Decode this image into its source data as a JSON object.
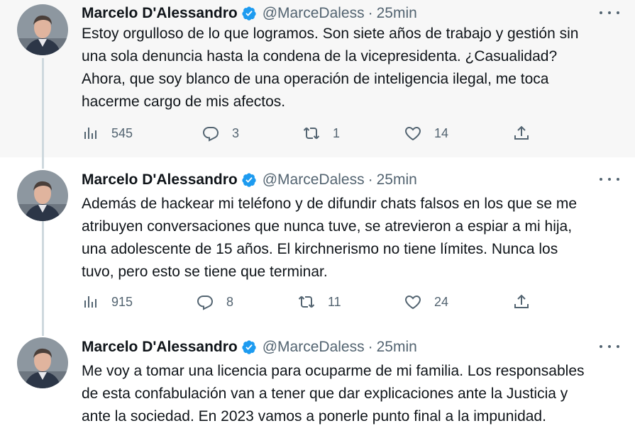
{
  "tweets": [
    {
      "author": {
        "name": "Marcelo D'Alessandro",
        "handle": "@MarceDaless",
        "verified": true
      },
      "separator": "·",
      "time": "25min",
      "text": "Estoy orgulloso de lo que logramos. Son siete años de trabajo y gestión sin\nuna sola denuncia hasta la condena de la vicepresidenta. ¿Casualidad?\nAhora, que soy blanco de una operación de inteligencia ilegal, me toca\nhacerme cargo de mis afectos.",
      "views": "545",
      "replies": "3",
      "retweets": "1",
      "likes": "14"
    },
    {
      "author": {
        "name": "Marcelo D'Alessandro",
        "handle": "@MarceDaless",
        "verified": true
      },
      "separator": "·",
      "time": "25min",
      "text": "Además de hackear mi teléfono y de difundir chats falsos en los que se me\natribuyen conversaciones que nunca tuve, se atrevieron a espiar a mi hija,\nuna adolescente de 15 años. El kirchnerismo no tiene límites. Nunca los\ntuvo, pero esto se tiene que terminar.",
      "views": "915",
      "replies": "8",
      "retweets": "11",
      "likes": "24"
    },
    {
      "author": {
        "name": "Marcelo D'Alessandro",
        "handle": "@MarceDaless",
        "verified": true
      },
      "separator": "·",
      "time": "25min",
      "text": "Me voy a tomar una licencia para ocuparme de mi familia. Los responsables\nde esta confabulación van a tener que dar explicaciones ante la Justicia y\nante la sociedad. En 2023 vamos a ponerle punto final a la impunidad."
    }
  ],
  "colors": {
    "text": "#0f1419",
    "secondary": "#536471",
    "verified": "#1d9bf0",
    "highlight_bg": "#f7f7f7",
    "thread_line": "#cfd9de"
  },
  "icons": {
    "views": "analytics-icon",
    "reply": "reply-icon",
    "retweet": "retweet-icon",
    "like": "heart-icon",
    "share": "share-icon",
    "more": "more-icon",
    "verified": "verified-badge-icon"
  }
}
